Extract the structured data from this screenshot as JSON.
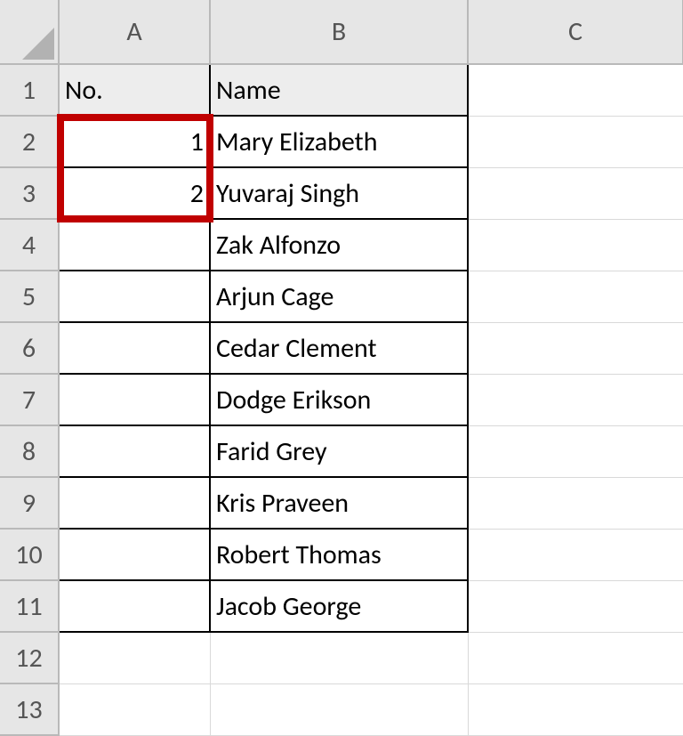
{
  "columns": {
    "A": "A",
    "B": "B",
    "C": "C"
  },
  "row_labels": [
    "1",
    "2",
    "3",
    "4",
    "5",
    "6",
    "7",
    "8",
    "9",
    "10",
    "11",
    "12",
    "13"
  ],
  "header": {
    "A": "No.",
    "B": "Name"
  },
  "rows": [
    {
      "no": "1",
      "name": "Mary Elizabeth"
    },
    {
      "no": "2",
      "name": "Yuvaraj Singh"
    },
    {
      "no": "",
      "name": "Zak Alfonzo"
    },
    {
      "no": "",
      "name": "Arjun Cage"
    },
    {
      "no": "",
      "name": "Cedar Clement"
    },
    {
      "no": "",
      "name": "Dodge Erikson"
    },
    {
      "no": "",
      "name": "Farid Grey"
    },
    {
      "no": "",
      "name": "Kris Praveen"
    },
    {
      "no": "",
      "name": "Robert Thomas"
    },
    {
      "no": "",
      "name": "Jacob George"
    }
  ],
  "chart_data": {
    "type": "table",
    "title": "",
    "columns": [
      "No.",
      "Name"
    ],
    "data": [
      [
        1,
        "Mary Elizabeth"
      ],
      [
        2,
        "Yuvaraj Singh"
      ],
      [
        null,
        "Zak Alfonzo"
      ],
      [
        null,
        "Arjun Cage"
      ],
      [
        null,
        "Cedar Clement"
      ],
      [
        null,
        "Dodge Erikson"
      ],
      [
        null,
        "Farid Grey"
      ],
      [
        null,
        "Kris Praveen"
      ],
      [
        null,
        "Robert Thomas"
      ],
      [
        null,
        "Jacob George"
      ]
    ]
  }
}
